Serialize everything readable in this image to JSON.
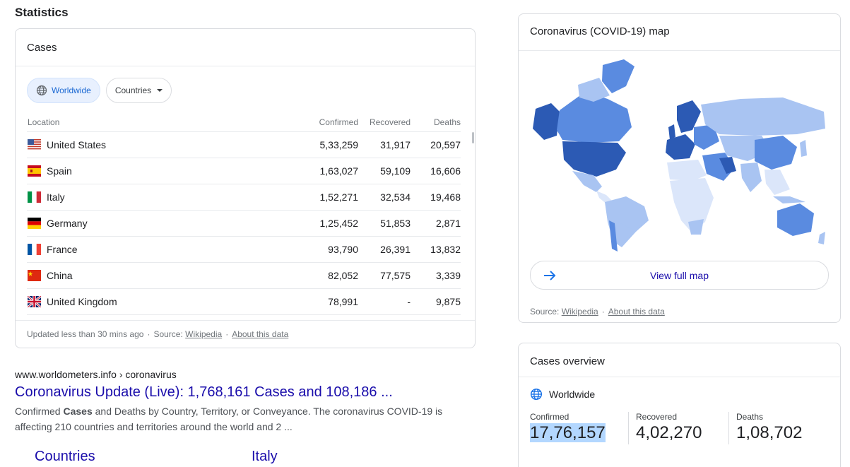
{
  "statistics_title": "Statistics",
  "cases": {
    "title": "Cases",
    "chips": {
      "worldwide": "Worldwide",
      "countries": "Countries"
    },
    "columns": {
      "location": "Location",
      "confirmed": "Confirmed",
      "recovered": "Recovered",
      "deaths": "Deaths"
    },
    "rows": [
      {
        "name": "United States",
        "confirmed": "5,33,259",
        "recovered": "31,917",
        "deaths": "20,597"
      },
      {
        "name": "Spain",
        "confirmed": "1,63,027",
        "recovered": "59,109",
        "deaths": "16,606"
      },
      {
        "name": "Italy",
        "confirmed": "1,52,271",
        "recovered": "32,534",
        "deaths": "19,468"
      },
      {
        "name": "Germany",
        "confirmed": "1,25,452",
        "recovered": "51,853",
        "deaths": "2,871"
      },
      {
        "name": "France",
        "confirmed": "93,790",
        "recovered": "26,391",
        "deaths": "13,832"
      },
      {
        "name": "China",
        "confirmed": "82,052",
        "recovered": "77,575",
        "deaths": "3,339"
      },
      {
        "name": "United Kingdom",
        "confirmed": "78,991",
        "recovered": "-",
        "deaths": "9,875"
      }
    ],
    "footer": {
      "updated": "Updated less than 30 mins ago",
      "source_label": "Source:",
      "source_link": "Wikipedia",
      "about": "About this data"
    }
  },
  "result": {
    "url": "www.worldometers.info › coronavirus",
    "title": "Coronavirus Update (Live): 1,768,161 Cases and 108,186 ...",
    "snippet_pre": "Confirmed ",
    "snippet_bold": "Cases",
    "snippet_post": " and Deaths by Country, Territory, or Conveyance. The coronavirus COVID-19 is affecting 210 countries and territories around the world and 2 ...",
    "sitelinks": [
      "Countries",
      "Italy"
    ]
  },
  "map": {
    "title": "Coronavirus (COVID-19) map",
    "view_full_map": "View full map",
    "source_label": "Source:",
    "source_link": "Wikipedia",
    "about": "About this data",
    "colors": {
      "dark": "#2c5ab4",
      "mid": "#5a8be0",
      "light": "#a9c4f2",
      "pale": "#dbe6fa"
    }
  },
  "overview": {
    "title": "Cases overview",
    "scope": "Worldwide",
    "confirmed_label": "Confirmed",
    "confirmed": "17,76,157",
    "recovered_label": "Recovered",
    "recovered": "4,02,270",
    "deaths_label": "Deaths",
    "deaths": "1,08,702"
  }
}
